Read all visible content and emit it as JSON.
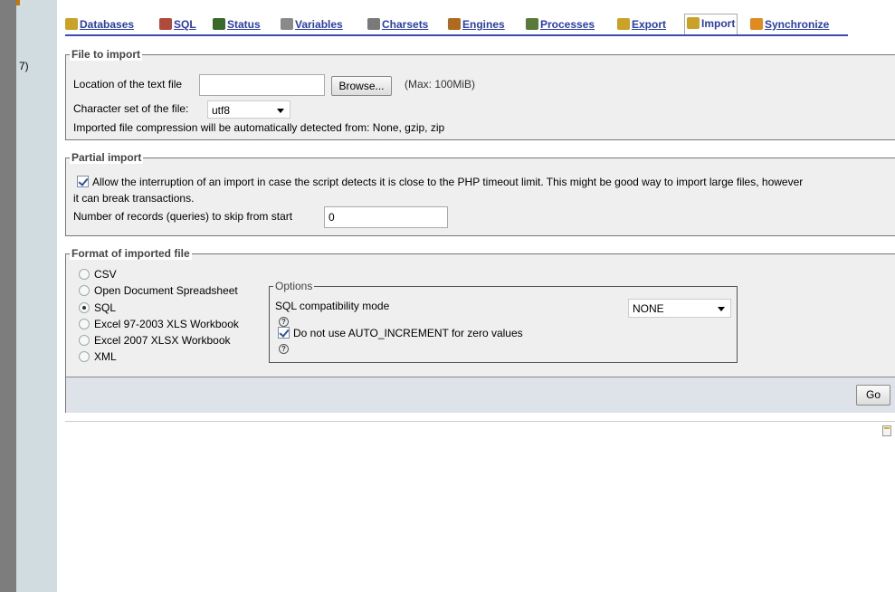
{
  "tabs": [
    {
      "label": "Databases",
      "icon": "databases-icon",
      "color": "#c9a227"
    },
    {
      "label": "SQL",
      "icon": "sql-icon",
      "color": "#b04a3a"
    },
    {
      "label": "Status",
      "icon": "status-icon",
      "color": "#3a6a2a"
    },
    {
      "label": "Variables",
      "icon": "variables-icon",
      "color": "#8a8a8a"
    },
    {
      "label": "Charsets",
      "icon": "charsets-icon",
      "color": "#7a7a7a"
    },
    {
      "label": "Engines",
      "icon": "engines-icon",
      "color": "#b06a20"
    },
    {
      "label": "Processes",
      "icon": "processes-icon",
      "color": "#5a7a3a"
    },
    {
      "label": "Export",
      "icon": "export-icon",
      "color": "#c9a227"
    },
    {
      "label": "Import",
      "icon": "import-icon",
      "color": "#c9a227",
      "active": true
    },
    {
      "label": "Synchronize",
      "icon": "synchronize-icon",
      "color": "#e08a20"
    }
  ],
  "nav": {
    "fragment": "7)"
  },
  "file_import": {
    "legend": "File to import",
    "location_label": "Location of the text file",
    "browse_label": "Browse...",
    "max_size": "(Max: 100MiB)",
    "charset_label": "Character set of the file:",
    "charset_value": "utf8",
    "compression_note": "Imported file compression will be automatically detected from: None, gzip, zip"
  },
  "partial_import": {
    "legend": "Partial import",
    "allow_interrupt_line1": "Allow the interruption of an import in case the script detects it is close to the PHP timeout limit. This might be good way to import large files, however",
    "allow_interrupt_line2": "it can break transactions.",
    "allow_interrupt_checked": true,
    "skip_label": "Number of records (queries) to skip from start",
    "skip_value": "0"
  },
  "format": {
    "legend": "Format of imported file",
    "options": [
      "CSV",
      "Open Document Spreadsheet",
      "SQL",
      "Excel 97-2003 XLS Workbook",
      "Excel 2007 XLSX Workbook",
      "XML"
    ],
    "selected": "SQL",
    "options_box": {
      "legend": "Options",
      "compat_label": "SQL compatibility mode",
      "compat_value": "NONE",
      "no_auto_inc_label": "Do not use AUTO_INCREMENT for zero values",
      "no_auto_inc_checked": true
    }
  },
  "go_label": "Go"
}
